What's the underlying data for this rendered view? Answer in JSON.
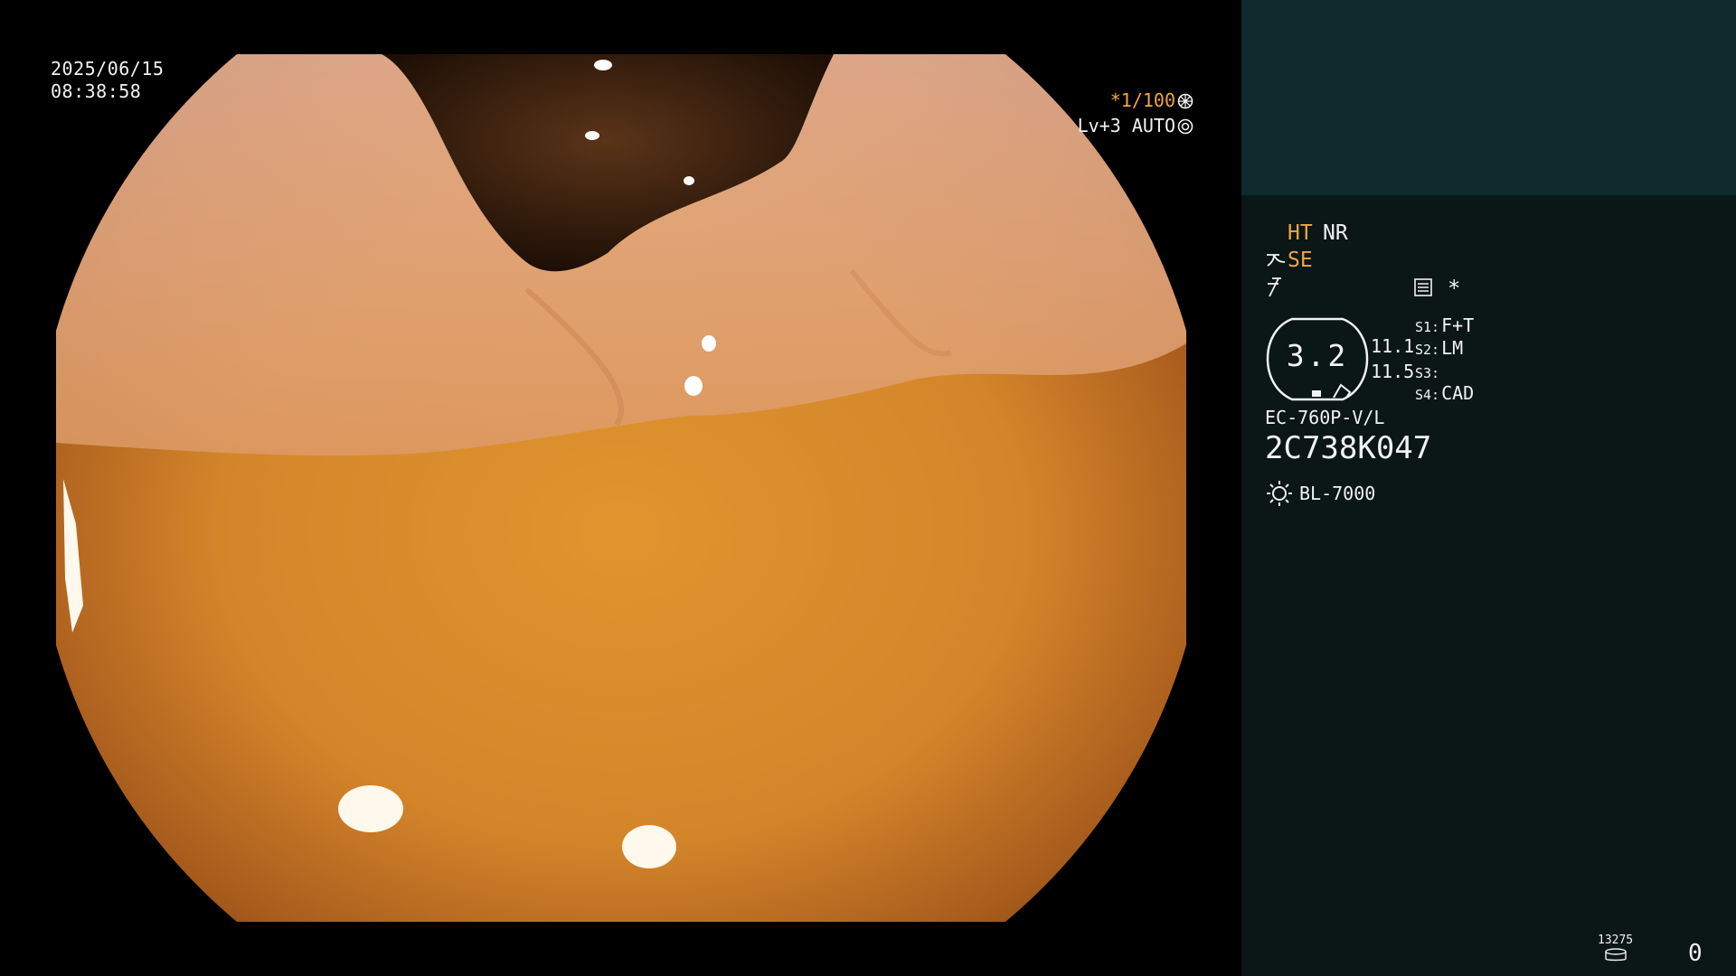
{
  "screen": {
    "date": "2025/06/15",
    "time": "08:38:58",
    "shutter": "*1/100",
    "level": "Lv+3",
    "iris_mode": "AUTO"
  },
  "info_panel": {
    "enhancement": "HT",
    "noise_reduction": "NR",
    "structure_enhancement": "SE",
    "star": "*",
    "gauge_value": "3.2",
    "gauge_a": "11.1",
    "gauge_b": "11.5",
    "switches": [
      {
        "key": "S1:",
        "value": "F+T"
      },
      {
        "key": "S2:",
        "value": "LM"
      },
      {
        "key": "S3:",
        "value": ""
      },
      {
        "key": "S4:",
        "value": "CAD"
      }
    ],
    "scope_model": "EC-760P-V/L",
    "scope_serial": "2C738K047",
    "light_source": "BL-7000",
    "image_counter_label": "13275",
    "image_counter_value": "0"
  },
  "colors": {
    "osd_text": "#f2f2f2",
    "osd_accent": "#f0a640",
    "panel_bg": "#0b1616",
    "thumbnail_bg": "#0e2a2c"
  },
  "icons": {
    "shutter": "aperture-icon",
    "iris": "iris-icon",
    "structure": "fibre-icon",
    "freeze": "freeze-icon",
    "document": "document-icon",
    "light": "sun-icon",
    "counter": "disk-stack-icon"
  }
}
